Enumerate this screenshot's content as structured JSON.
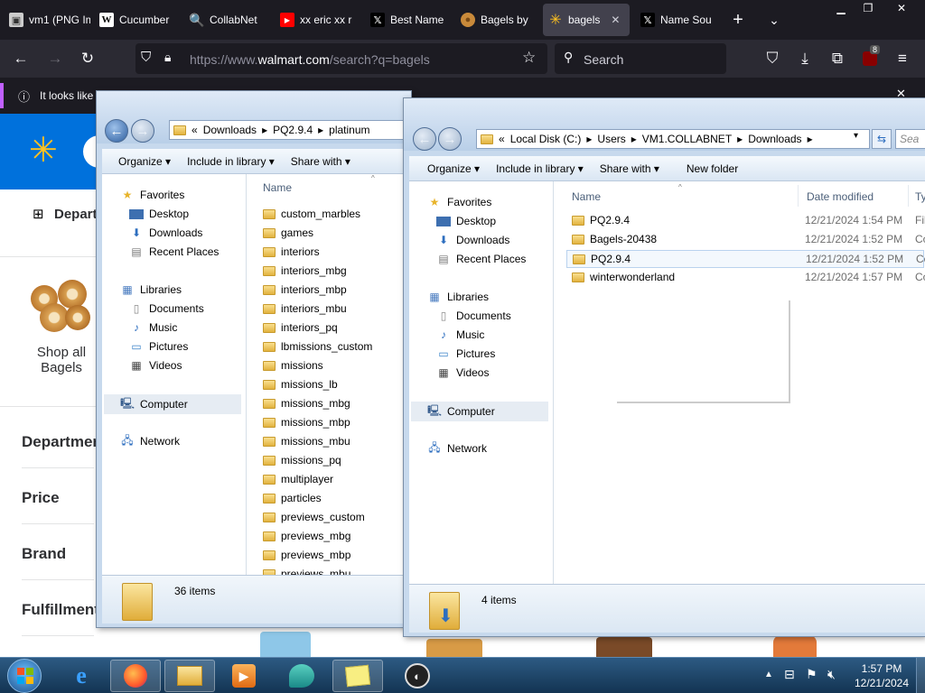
{
  "browser": {
    "tabs": [
      {
        "label": "vm1 (PNG Ima",
        "icon": "image-icon"
      },
      {
        "label": "Cucumber",
        "icon": "wikipedia-icon"
      },
      {
        "label": "CollabNet",
        "icon": "search-icon"
      },
      {
        "label": "xx eric xx r",
        "icon": "youtube-icon"
      },
      {
        "label": "Best Name",
        "icon": "x-icon"
      },
      {
        "label": "Bagels by",
        "icon": "bagel-icon"
      },
      {
        "label": "bagels",
        "icon": "walmart-spark-icon"
      },
      {
        "label": "Name Sou",
        "icon": "x-icon"
      }
    ],
    "new_tab": "+",
    "url_prefix": "https://www.",
    "url_domain": "walmart.com",
    "url_path": "/search?q=bagels",
    "search_placeholder": "Search",
    "extension_badge": "8",
    "notification_text": "It looks like"
  },
  "walmart": {
    "departments_label": "Depart",
    "shop_all_line1": "Shop all",
    "shop_all_line2": "Bagels",
    "facets": [
      "Departmen",
      "Price",
      "Brand",
      "Fulfillment"
    ]
  },
  "explorer_left": {
    "breadcrumb": [
      "Downloads",
      "PQ2.9.4",
      "platinum"
    ],
    "commands": [
      "Organize",
      "Include in library",
      "Share with"
    ],
    "nav": {
      "favorites": "Favorites",
      "favorites_items": [
        "Desktop",
        "Downloads",
        "Recent Places"
      ],
      "libraries": "Libraries",
      "libraries_items": [
        "Documents",
        "Music",
        "Pictures",
        "Videos"
      ],
      "computer": "Computer",
      "network": "Network"
    },
    "column_name": "Name",
    "files": [
      "custom_marbles",
      "games",
      "interiors",
      "interiors_mbg",
      "interiors_mbp",
      "interiors_mbu",
      "interiors_pq",
      "lbmissions_custom",
      "missions",
      "missions_lb",
      "missions_mbg",
      "missions_mbp",
      "missions_mbu",
      "missions_pq",
      "multiplayer",
      "particles",
      "previews_custom",
      "previews_mbg",
      "previews_mbp",
      "previews_mbu"
    ],
    "status": "36 items"
  },
  "explorer_right": {
    "breadcrumb": [
      "Local Disk (C:)",
      "Users",
      "VM1.COLLABNET",
      "Downloads"
    ],
    "search_placeholder": "Sea",
    "commands": [
      "Organize",
      "Include in library",
      "Share with",
      "New folder"
    ],
    "nav": {
      "favorites": "Favorites",
      "favorites_items": [
        "Desktop",
        "Downloads",
        "Recent Places"
      ],
      "libraries": "Libraries",
      "libraries_items": [
        "Documents",
        "Music",
        "Pictures",
        "Videos"
      ],
      "computer": "Computer",
      "network": "Network"
    },
    "columns": [
      "Name",
      "Date modified",
      "Ty"
    ],
    "files": [
      {
        "name": "PQ2.9.4",
        "date": "12/21/2024 1:54 PM",
        "type": "Fil"
      },
      {
        "name": "Bagels-20438",
        "date": "12/21/2024 1:52 PM",
        "type": "Co"
      },
      {
        "name": "PQ2.9.4",
        "date": "12/21/2024 1:52 PM",
        "type": "Co"
      },
      {
        "name": "winterwonderland",
        "date": "12/21/2024 1:57 PM",
        "type": "Co"
      }
    ],
    "status": "4 items"
  },
  "taskbar": {
    "time": "1:57 PM",
    "date": "12/21/2024"
  }
}
